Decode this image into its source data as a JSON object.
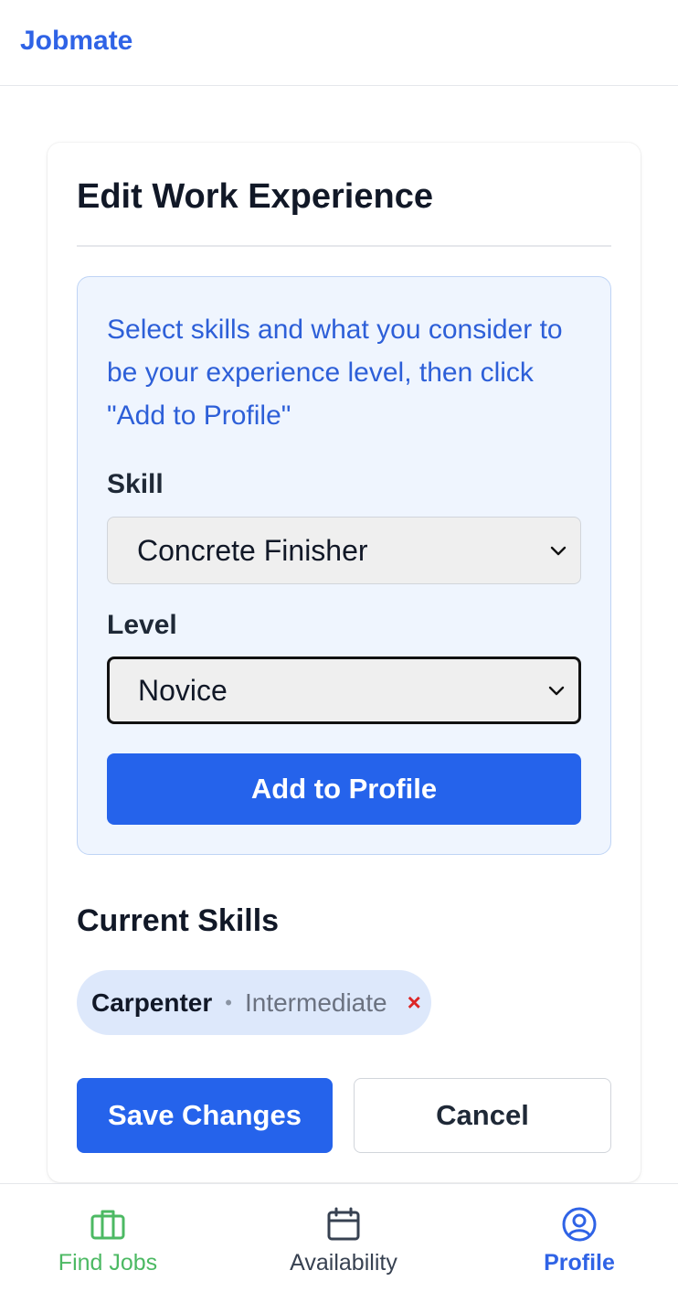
{
  "app": {
    "brand": "Jobmate"
  },
  "card": {
    "title": "Edit Work Experience",
    "info_text": "Select skills and what you consider to be your experience level, then click \"Add to Profile\"",
    "skill_label": "Skill",
    "skill_value": "Concrete Finisher",
    "level_label": "Level",
    "level_value": "Novice",
    "add_button": "Add to Profile",
    "current_skills_title": "Current Skills",
    "skills": [
      {
        "name": "Carpenter",
        "separator": "•",
        "level": "Intermediate",
        "remove": "×"
      }
    ],
    "save_button": "Save Changes",
    "cancel_button": "Cancel"
  },
  "nav": {
    "items": [
      {
        "label": "Find Jobs",
        "icon": "briefcase-icon",
        "color": "#4cb963"
      },
      {
        "label": "Availability",
        "icon": "calendar-icon",
        "color": "#374151"
      },
      {
        "label": "Profile",
        "icon": "user-circle-icon",
        "color": "#2f63e6",
        "active": true
      }
    ]
  },
  "colors": {
    "brand": "#2f63e6",
    "primary_button": "#2563eb",
    "info_bg": "#eff5fe",
    "chip_bg": "#dde8fb",
    "remove": "#dc2626"
  }
}
